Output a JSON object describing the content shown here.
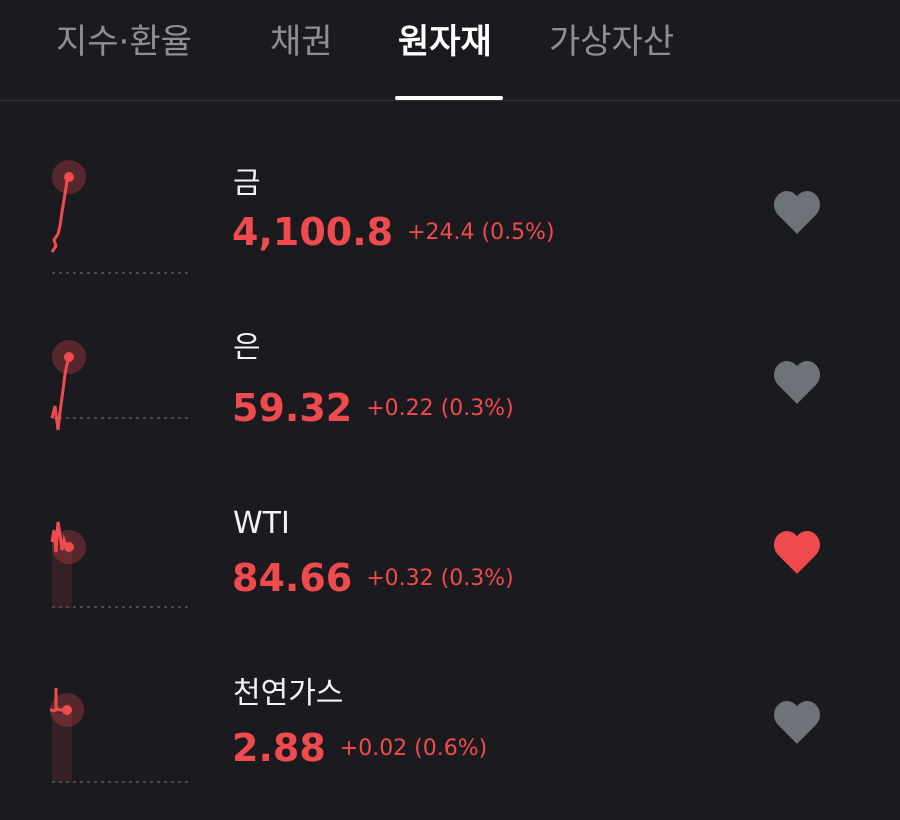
{
  "tabs": [
    {
      "label": "지수·환율"
    },
    {
      "label": "채권"
    },
    {
      "label": "원자재"
    },
    {
      "label": "가상자산"
    }
  ],
  "active_tab": "원자재",
  "items": [
    {
      "name": "금",
      "price": "4,100.8",
      "change": "+24.4 (0.5%)",
      "favorite": false
    },
    {
      "name": "은",
      "price": "59.32",
      "change": "+0.22 (0.3%)",
      "favorite": false
    },
    {
      "name": "WTI",
      "price": "84.66",
      "change": "+0.32 (0.3%)",
      "favorite": true
    },
    {
      "name": "천연가스",
      "price": "2.88",
      "change": "+0.02 (0.6%)",
      "favorite": false
    }
  ],
  "colors": {
    "background": "#1b1b1f",
    "up": "#ef4b4f",
    "heart_inactive": "#6e7279",
    "heart_active": "#ef4b4f",
    "tab_inactive": "#8e8e95",
    "tab_active": "#ffffff"
  },
  "icons": {
    "favorite": "heart-icon"
  }
}
